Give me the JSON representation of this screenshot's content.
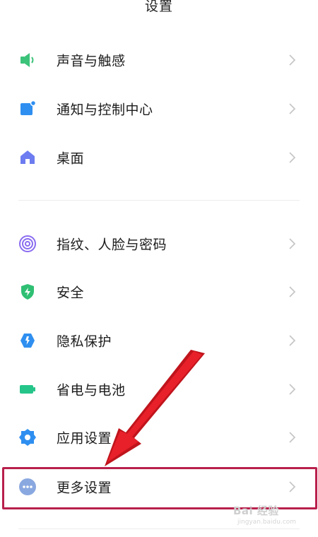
{
  "header": {
    "title": "设置"
  },
  "settings": {
    "items": [
      {
        "label": "声音与触感",
        "icon": "speaker-icon",
        "color": "#3cc37a"
      },
      {
        "label": "通知与控制中心",
        "icon": "notification-icon",
        "color": "#2f8ff0"
      },
      {
        "label": "桌面",
        "icon": "home-icon",
        "color": "#6d7cf0"
      },
      {
        "label": "指纹、人脸与密码",
        "icon": "fingerprint-icon",
        "color": "#8a6cf0"
      },
      {
        "label": "安全",
        "icon": "shield-icon",
        "color": "#2fbf73"
      },
      {
        "label": "隐私保护",
        "icon": "privacy-icon",
        "color": "#2f8ff0"
      },
      {
        "label": "省电与电池",
        "icon": "battery-icon",
        "color": "#25c58a"
      },
      {
        "label": "应用设置",
        "icon": "gear-icon",
        "color": "#2f8ff0"
      },
      {
        "label": "更多设置",
        "icon": "more-icon",
        "color": "#8aa8e0"
      }
    ]
  },
  "annotation": {
    "highlight_color": "#b8204c",
    "arrow_color": "#e8202a"
  },
  "watermark": {
    "text": "Bai 经验",
    "sub": "jingyan.baidu.com"
  }
}
